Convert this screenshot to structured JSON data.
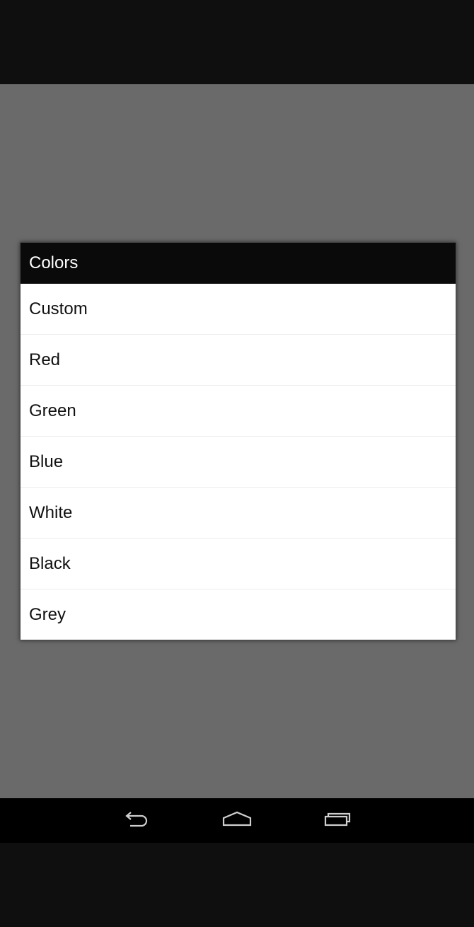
{
  "dialog": {
    "title": "Colors",
    "options": [
      {
        "label": "Custom"
      },
      {
        "label": "Red"
      },
      {
        "label": "Green"
      },
      {
        "label": "Blue"
      },
      {
        "label": "White"
      },
      {
        "label": "Black"
      },
      {
        "label": "Grey"
      }
    ]
  },
  "navigation_bar": {
    "buttons": [
      {
        "icon": "back-icon"
      },
      {
        "icon": "home-icon"
      },
      {
        "icon": "recent-apps-icon"
      }
    ]
  },
  "colors": {
    "scrim": "#6a6a6a",
    "dialog_title_bg": "#0a0a0a",
    "dialog_bg": "#ffffff",
    "nav_bar_bg": "#000000",
    "screen_bg": "#0f0f0f"
  }
}
